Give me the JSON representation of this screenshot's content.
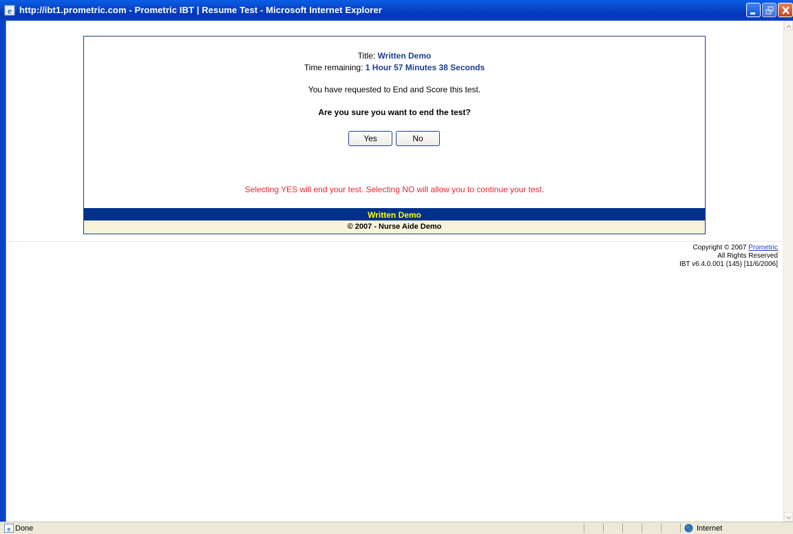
{
  "window": {
    "title": "http://ibt1.prometric.com - Prometric IBT | Resume Test - Microsoft Internet Explorer",
    "icon": "ie-icon",
    "controls": [
      "minimize-icon",
      "restore-icon",
      "close-icon"
    ]
  },
  "dialog": {
    "title_label": "Title: ",
    "title_value": "Written Demo",
    "time_label": "Time remaining: ",
    "time_value": "1 Hour 57 Minutes 38 Seconds",
    "message": "You have requested to End and Score this test.",
    "question": "Are you sure you want to end the test?",
    "yes_label": "Yes",
    "no_label": "No",
    "warning": "Selecting YES will end your test. Selecting NO will allow you to continue your test.",
    "footer_title": "Written Demo",
    "footer_copyright": "© 2007 - Nurse Aide Demo"
  },
  "copyright": {
    "line1_prefix": "Copyright © 2007 ",
    "line1_link": "Prometric",
    "line2": "All Rights Reserved",
    "line3": "IBT v6.4.0.001 (145) [11/6/2006]"
  },
  "statusbar": {
    "status": "Done",
    "zone": "Internet"
  },
  "colors": {
    "titlebar": "#0846c8",
    "panel_border": "#1b3e8f",
    "accent_text": "#1b3e8f",
    "warning_text": "#e8262a",
    "footer_bar": "#00318c",
    "footer_text": "#ffff00",
    "footer_band": "#f7f3d8"
  }
}
